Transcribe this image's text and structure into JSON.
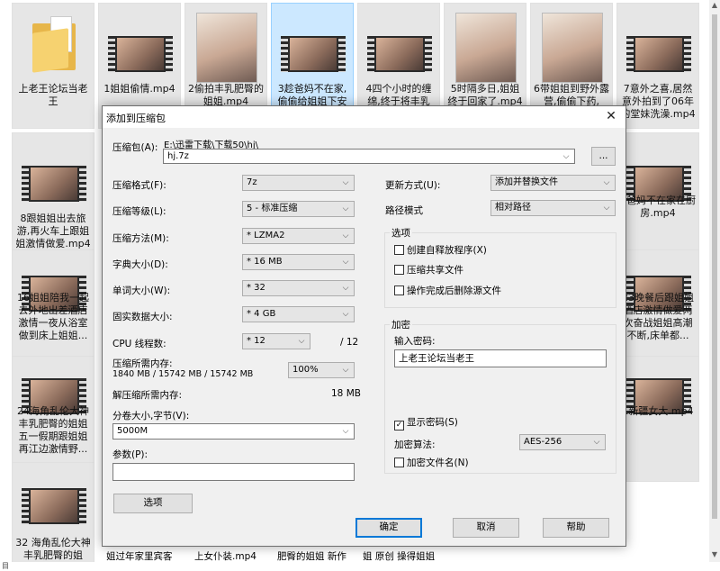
{
  "explorer": {
    "row1": [
      {
        "label": "上老王论坛当老王",
        "type": "folder"
      },
      {
        "label": "1姐姐偷情.mp4",
        "type": "video"
      },
      {
        "label": "2偷拍丰乳肥臀的姐姐.mp4",
        "type": "photo"
      },
      {
        "label": "3趁爸妈不在家,偷偷给姐姐下安",
        "type": "video"
      },
      {
        "label": "4四个小时的缠绵,终于将丰乳",
        "type": "video"
      },
      {
        "label": "5时隔多日,姐姐终于回家了.mp4",
        "type": "photo"
      },
      {
        "label": "6带姐姐到野外露营,偷偷下药,",
        "type": "photo"
      },
      {
        "label": "7意外之喜,居然意外拍到了06年的堂妹洗澡.mp4",
        "type": "video"
      }
    ],
    "row2": [
      {
        "label": "8跟姐姐出去旅游,再火车上跟姐姐激情做爱.mp4",
        "type": "video"
      },
      {
        "label": "5爸妈不在家在厨房.mp4",
        "type": "video"
      }
    ],
    "row3": [
      {
        "label": "16姐姐陪我一起去外地出差酒店激情一夜从浴室做到床上姐姐...",
        "type": "video"
      },
      {
        "label": "23晚餐后跟姐姐酒店激情做爱两次奋战姐姐高潮不断,床单都...",
        "type": "video"
      }
    ],
    "row4": [
      {
        "label": "24海角乱伦大神丰乳肥臀的姐姐五一假期跟姐姐再江边激情野...",
        "type": "video"
      },
      {
        "label": "1新疆女大.mp4",
        "type": "video"
      }
    ],
    "row5": [
      {
        "label": "32 海角乱伦大神丰乳肥臀的姐",
        "type": "video"
      }
    ],
    "bottom_partial": [
      "姐过年家里宾客",
      "上女仆装.mp4",
      "肥臀的姐姐 新作",
      "姐 原创 操得姐姐"
    ],
    "status_text": "目"
  },
  "dialog": {
    "title": "添加到压缩包",
    "close_glyph": "✕",
    "archive_label": "压缩包(A):",
    "archive_path": "E:\\迅雷下载\\下载50\\hj\\",
    "archive_name": "hj.7z",
    "browse_label": "...",
    "format_label": "压缩格式(F):",
    "format_value": "7z",
    "level_label": "压缩等级(L):",
    "level_value": "5 - 标准压缩",
    "method_label": "压缩方法(M):",
    "method_value": "* LZMA2",
    "dict_label": "字典大小(D):",
    "dict_value": "* 16 MB",
    "word_label": "单词大小(W):",
    "word_value": "* 32",
    "solid_label": "固实数据大小:",
    "solid_value": "* 4 GB",
    "threads_label": "CPU 线程数:",
    "threads_value": "* 12",
    "threads_max": "/ 12",
    "mem_comp_label": "压缩所需内存:",
    "mem_comp_value": "1840 MB / 15742 MB / 15742 MB",
    "mem_percent": "100%",
    "mem_decomp_label": "解压缩所需内存:",
    "mem_decomp_value": "18 MB",
    "split_label": "分卷大小,字节(V):",
    "split_value": "5000M",
    "params_label": "参数(P):",
    "params_value": "",
    "options_button": "选项",
    "update_label": "更新方式(U):",
    "update_value": "添加并替换文件",
    "path_label": "路径模式",
    "path_value": "相对路径",
    "options_group": "选项",
    "opt_sfx": "创建自释放程序(X)",
    "opt_shared": "压缩共享文件",
    "opt_delete": "操作完成后删除源文件",
    "encrypt_group": "加密",
    "password_label": "输入密码:",
    "password_value": "上老王论坛当老王",
    "show_password": "显示密码(S)",
    "encrypt_method_label": "加密算法:",
    "encrypt_method_value": "AES-256",
    "encrypt_names": "加密文件名(N)",
    "ok": "确定",
    "cancel": "取消",
    "help": "帮助"
  }
}
